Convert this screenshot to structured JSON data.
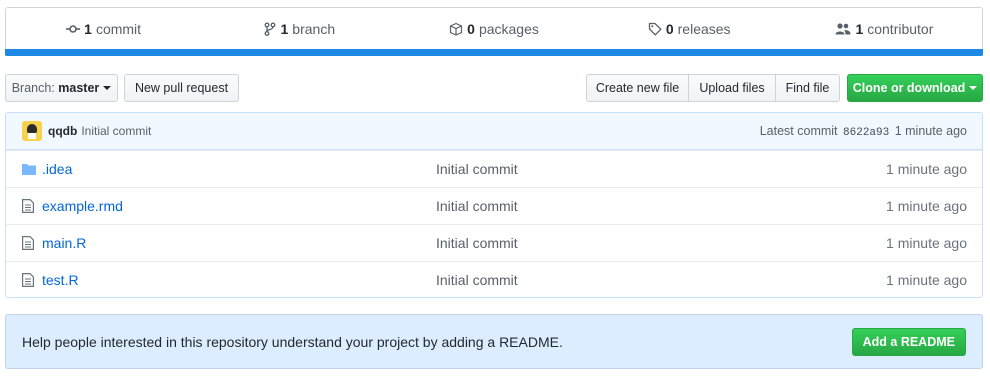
{
  "summary": {
    "commits": {
      "count": "1",
      "label": "commit"
    },
    "branches": {
      "count": "1",
      "label": "branch"
    },
    "packages": {
      "count": "0",
      "label": "packages"
    },
    "releases": {
      "count": "0",
      "label": "releases"
    },
    "contributors": {
      "count": "1",
      "label": "contributor"
    },
    "language_color": "#1e88e5"
  },
  "toolbar": {
    "branch_prefix": "Branch:",
    "branch_name": "master",
    "new_pull_request": "New pull request",
    "create_new_file": "Create new file",
    "upload_files": "Upload files",
    "find_file": "Find file",
    "clone_or_download": "Clone or download"
  },
  "latest_commit": {
    "author": "qqdb",
    "message": "Initial commit",
    "label": "Latest commit",
    "sha": "8622a93",
    "age": "1 minute ago"
  },
  "files": [
    {
      "name": ".idea",
      "type": "folder",
      "message": "Initial commit",
      "age": "1 minute ago"
    },
    {
      "name": "example.rmd",
      "type": "file",
      "message": "Initial commit",
      "age": "1 minute ago"
    },
    {
      "name": "main.R",
      "type": "file",
      "message": "Initial commit",
      "age": "1 minute ago"
    },
    {
      "name": "test.R",
      "type": "file",
      "message": "Initial commit",
      "age": "1 minute ago"
    }
  ],
  "readme_prompt": {
    "text": "Help people interested in this repository understand your project by adding a README.",
    "button": "Add a README"
  },
  "colors": {
    "link": "#0366d6",
    "green": "#28a745",
    "readme_bg": "#dbedff"
  }
}
